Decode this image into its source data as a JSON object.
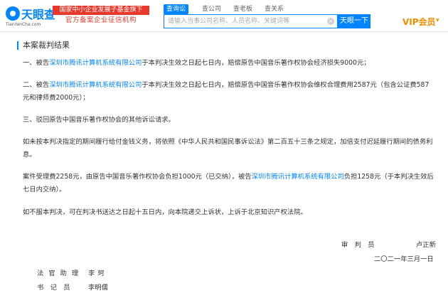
{
  "header": {
    "logo_text": "天眼查",
    "logo_domain": "TianYanCha.com",
    "badge_top": "国家中小企业发展子基金旗下",
    "badge_bottom": "官方备案企业征信机构",
    "tabs": [
      {
        "label": "查询讼",
        "active": true
      },
      {
        "label": "查公司",
        "active": false
      },
      {
        "label": "查老板",
        "active": false
      },
      {
        "label": "查关系",
        "active": false
      }
    ],
    "search_placeholder": "请输入当事公司名称、人员名称、关键词等",
    "clear_icon": "×",
    "search_button": "天眼一下",
    "vip_label": "VIP会员",
    "vip_caret": "▾"
  },
  "content": {
    "section_title": "本案裁判结果",
    "p1": {
      "prefix": "一、被告",
      "company": "深圳市腾讯计算机系统有限公司",
      "suffix": "于本判决生效之日起七日内，赔偿原告中国音乐著作权协会经济损失9000元；"
    },
    "p2": {
      "prefix": "二、被告",
      "company": "深圳市腾讯计算机系统有限公司",
      "suffix": "于本判决生效之日起七日内，赔偿原告中国音乐著作权协会维权合理费用2587元（包含公证费587元和律师费2000元）；"
    },
    "p3": "三、驳回原告中国音乐著作权协会的其他诉讼请求。",
    "p4": "如未按本判决指定的期间履行给付金钱义务，将依照《中华人民共和国民事诉讼法》第二百五十三条之规定，加倍支付迟延履行期间的债务利息。",
    "p5": {
      "prefix": "案件受理费2258元，由原告中国音乐著作权协会负担1000元（已交纳），被告",
      "company": "深圳市腾讯计算机系统有限公司",
      "suffix": "负担1258元（于本判决生效后七日内交纳）。"
    },
    "p6": "如不服本判决，可在判决书送达之日起十五日内，向本院递交上诉状，上诉于北京知识产权法院。",
    "judge_title": "审　判　员",
    "judge_name": "卢正新",
    "date": "二〇二一年三月一日",
    "assistant_title": "法官助理",
    "assistant_name": "李珂",
    "clerk_title": "书　记　员",
    "clerk_name": "李明儒"
  },
  "colors": {
    "brand_blue": "#0084ff",
    "badge_red": "#e8382c",
    "vip_orange": "#f08c00"
  }
}
